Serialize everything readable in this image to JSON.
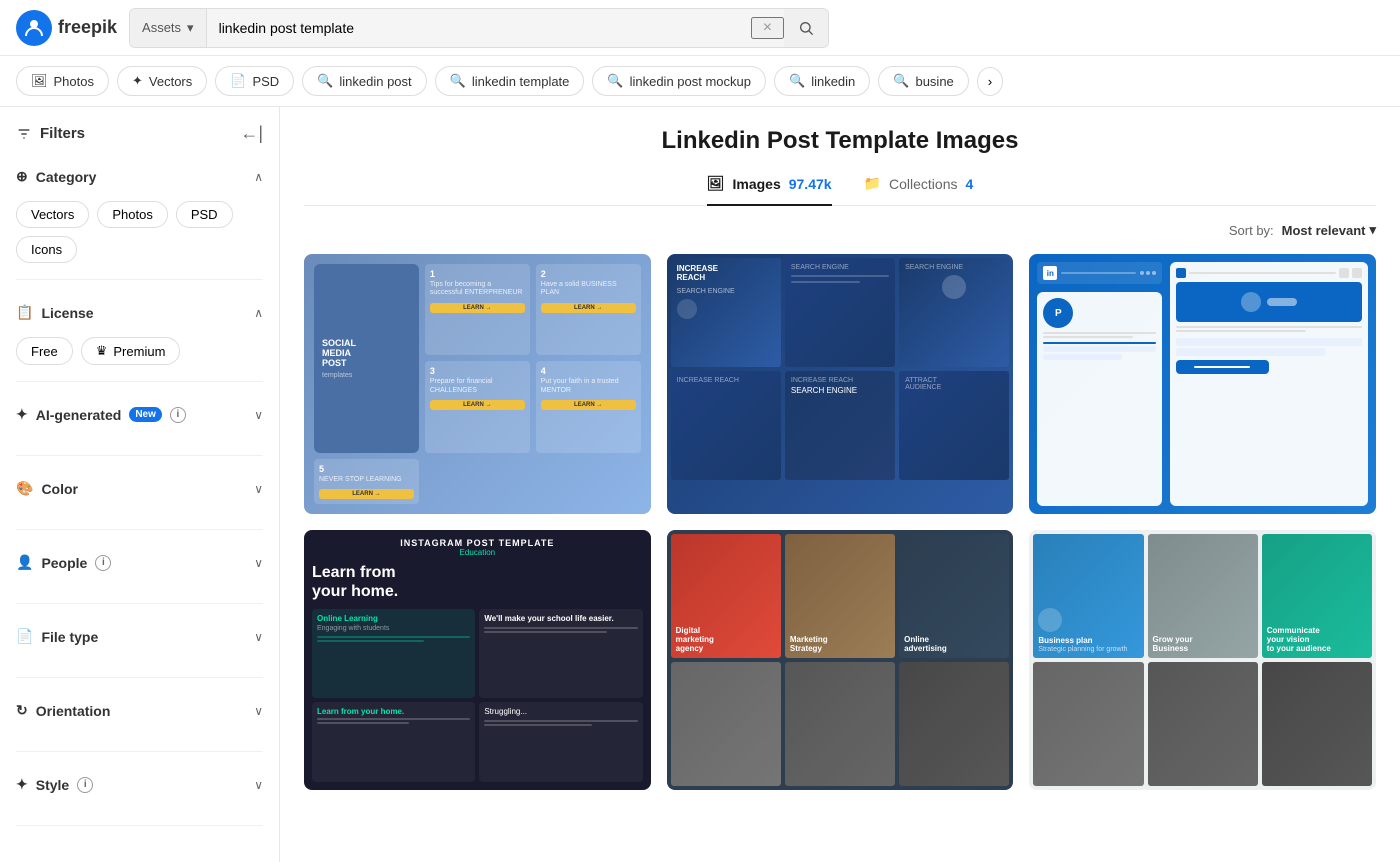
{
  "header": {
    "logo_text": "freepik",
    "search_dropdown_label": "Assets",
    "search_value": "linkedin post template",
    "search_clear_label": "×",
    "search_submit_icon": "search"
  },
  "filter_bar": {
    "chips": [
      {
        "id": "photos",
        "label": "Photos",
        "icon": "🖼",
        "active": false
      },
      {
        "id": "vectors",
        "label": "Vectors",
        "icon": "✦",
        "active": false
      },
      {
        "id": "psd",
        "label": "PSD",
        "icon": "📄",
        "active": false
      },
      {
        "id": "linkedin-post",
        "label": "linkedin post",
        "icon": "🔍",
        "active": false
      },
      {
        "id": "linkedin-template",
        "label": "linkedin template",
        "icon": "🔍",
        "active": false
      },
      {
        "id": "linkedin-post-mockup",
        "label": "linkedin post mockup",
        "icon": "🔍",
        "active": false
      },
      {
        "id": "linkedin",
        "label": "linkedin",
        "icon": "🔍",
        "active": false
      },
      {
        "id": "busine",
        "label": "busine",
        "icon": "🔍",
        "active": false
      }
    ],
    "nav_next": "›"
  },
  "sidebar": {
    "title": "Filters",
    "collapse_icon": "←|",
    "sections": [
      {
        "id": "category",
        "title": "Category",
        "icon": "⊕",
        "chips": [
          "Vectors",
          "Photos",
          "PSD",
          "Icons"
        ]
      },
      {
        "id": "license",
        "title": "License",
        "icon": "📋",
        "chips": [
          "Free",
          "Premium"
        ]
      },
      {
        "id": "ai-generated",
        "title": "AI-generated",
        "icon": "✦",
        "badge": "New",
        "has_info": true
      },
      {
        "id": "color",
        "title": "Color",
        "icon": "🎨"
      },
      {
        "id": "people",
        "title": "People",
        "icon": "👤",
        "has_info": true
      },
      {
        "id": "file-type",
        "title": "File type",
        "icon": "📄"
      },
      {
        "id": "orientation",
        "title": "Orientation",
        "icon": "↻"
      },
      {
        "id": "style",
        "title": "Style",
        "icon": "✦",
        "has_info": true
      }
    ]
  },
  "content": {
    "page_title": "Linkedin Post Template Images",
    "tabs": [
      {
        "id": "images",
        "label": "Images",
        "count": "97.47k",
        "active": true,
        "icon": "🖼"
      },
      {
        "id": "collections",
        "label": "Collections",
        "count": "4",
        "active": false,
        "icon": "📁"
      }
    ],
    "sort_label": "Sort by:",
    "sort_value": "Most relevant",
    "cards": [
      {
        "id": "card-social",
        "type": "social-media",
        "title": "SOCIAL MEDIA POST templates",
        "items": [
          {
            "num": "1",
            "text": "Tips for becoming a successful ENTERPRENEUR"
          },
          {
            "num": "2",
            "text": "Have a solid BUSINESS PLAN"
          },
          {
            "num": "3",
            "text": "Prepare for financial CHALLENGES"
          },
          {
            "num": "4",
            "text": "Put your faith in a trusted MENTOR"
          },
          {
            "num": "5",
            "text": "NEVER STOP LEARNING"
          }
        ]
      },
      {
        "id": "card-search-engine",
        "type": "search-grid",
        "items": [
          {
            "label": "INCREASE REACH",
            "sub": "SEARCH ENGINE"
          },
          {
            "label": "SEARCH ENGINE",
            "sub": ""
          },
          {
            "label": "SEARCH ENGINE",
            "sub": ""
          },
          {
            "label": "",
            "sub": ""
          },
          {
            "label": "INCREASE REACH",
            "sub": ""
          },
          {
            "label": "ATTRACT AUDIENCE",
            "sub": ""
          }
        ]
      },
      {
        "id": "card-linkedin-profile",
        "type": "linkedin-ui",
        "title": "LinkedIn"
      },
      {
        "id": "card-instagram",
        "type": "instagram",
        "badge_label": "INSTAGRAM POST TEMPLATE",
        "badge_sub": "Education",
        "title": "Learn from your home.",
        "items": [
          {
            "title": "Online Learning",
            "sub": ""
          },
          {
            "title": "We'll make your school life easier.",
            "sub": ""
          },
          {
            "title": "Learn from your home.",
            "sub": ""
          },
          {
            "title": "Stru...",
            "sub": ""
          }
        ]
      },
      {
        "id": "card-marketing",
        "type": "marketing-photos",
        "items": [
          {
            "label": "Digital marketing agency",
            "color": "#c0392b"
          },
          {
            "label": "Marketing Strategy",
            "color": "#8B7355"
          },
          {
            "label": "Online advertising",
            "color": "#2c3e50"
          },
          {
            "label": "",
            "color": "#555"
          },
          {
            "label": "",
            "color": "#444"
          },
          {
            "label": "",
            "color": "#333"
          }
        ]
      },
      {
        "id": "card-business-plan",
        "type": "business-plan",
        "items": [
          {
            "label": "Business plan",
            "color": "#2980b9"
          },
          {
            "label": "Grow your Business",
            "color": "#7f8c8d"
          },
          {
            "label": "Communicate your vision to your audience",
            "color": "#16a085"
          },
          {
            "label": "",
            "color": "#555"
          },
          {
            "label": "",
            "color": "#444"
          },
          {
            "label": "",
            "color": "#333"
          }
        ]
      }
    ]
  }
}
